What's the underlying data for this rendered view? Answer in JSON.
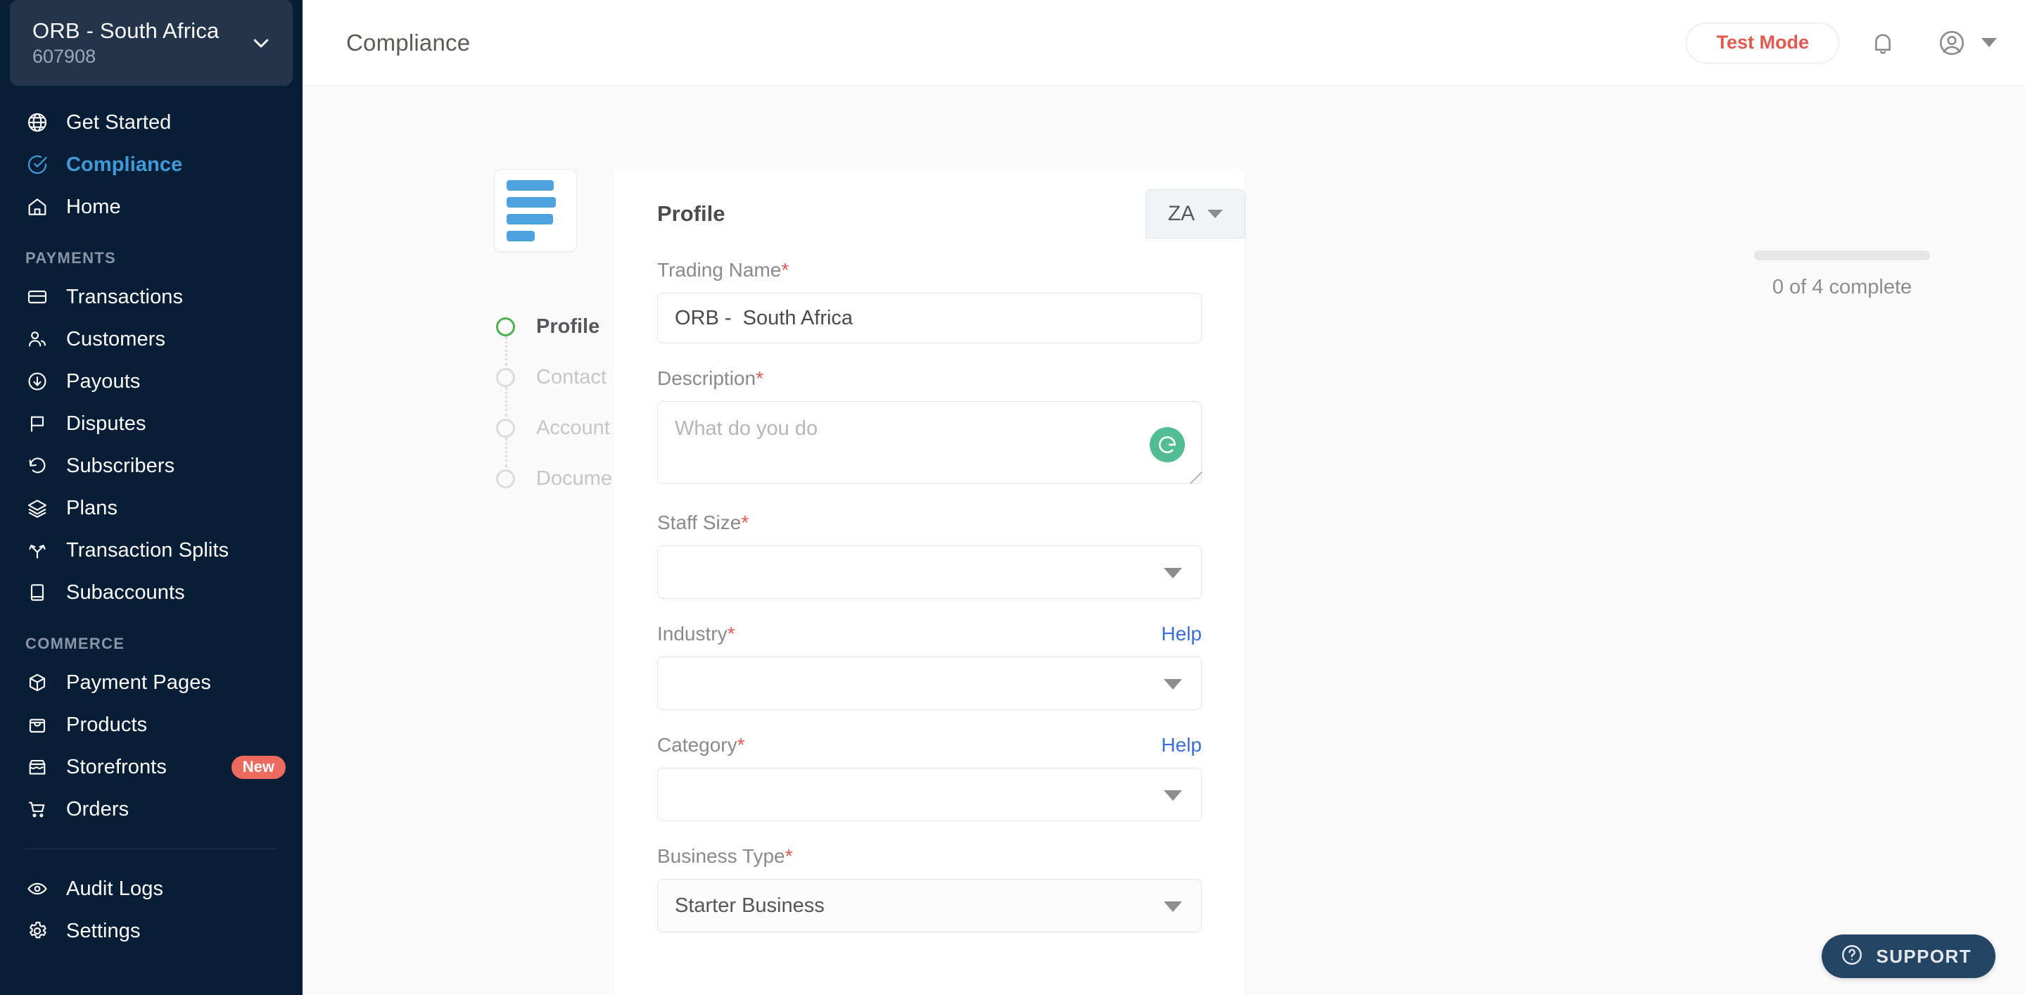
{
  "sidebar": {
    "account": {
      "name": "ORB - South Africa",
      "id": "607908",
      "chevron_icon": "chevron-down-icon"
    },
    "primary": [
      {
        "label": "Get Started",
        "icon": "globe-icon",
        "active": false
      },
      {
        "label": "Compliance",
        "icon": "check-circle-icon",
        "active": true
      },
      {
        "label": "Home",
        "icon": "home-icon",
        "active": false
      }
    ],
    "sections": [
      {
        "title": "PAYMENTS",
        "items": [
          {
            "label": "Transactions",
            "icon": "card-icon"
          },
          {
            "label": "Customers",
            "icon": "users-icon"
          },
          {
            "label": "Payouts",
            "icon": "arrow-down-circle-icon"
          },
          {
            "label": "Disputes",
            "icon": "flag-icon"
          },
          {
            "label": "Subscribers",
            "icon": "refresh-ccw-icon"
          },
          {
            "label": "Plans",
            "icon": "layers-icon"
          },
          {
            "label": "Transaction Splits",
            "icon": "split-icon"
          },
          {
            "label": "Subaccounts",
            "icon": "book-icon"
          }
        ]
      },
      {
        "title": "COMMERCE",
        "items": [
          {
            "label": "Payment Pages",
            "icon": "package-icon"
          },
          {
            "label": "Products",
            "icon": "shopping-bag-icon"
          },
          {
            "label": "Storefronts",
            "icon": "storefront-icon",
            "badge": "New"
          },
          {
            "label": "Orders",
            "icon": "shopping-cart-icon"
          }
        ]
      }
    ],
    "footer_items": [
      {
        "label": "Audit Logs",
        "icon": "eye-icon"
      },
      {
        "label": "Settings",
        "icon": "gear-icon"
      }
    ]
  },
  "topbar": {
    "title": "Compliance",
    "test_mode_label": "Test Mode",
    "bell_icon": "bell-icon",
    "avatar_icon": "user-circle-icon",
    "caret_icon": "caret-down-icon",
    "accent_red": "#e2594f"
  },
  "stepper": {
    "logo_alt": "business-logo-placeholder",
    "steps": [
      {
        "label": "Profile",
        "state": "current"
      },
      {
        "label": "Contact",
        "state": "pending"
      },
      {
        "label": "Account",
        "state": "pending"
      },
      {
        "label": "Documents",
        "state": "pending"
      }
    ]
  },
  "form": {
    "card_title": "Profile",
    "country": {
      "code": "ZA",
      "chevron_icon": "caret-down-icon"
    },
    "required_marker": "*",
    "help_label": "Help",
    "fields": [
      {
        "label": "Trading Name",
        "value": "ORB -  South Africa",
        "placeholder": "",
        "type": "text",
        "required": true
      },
      {
        "label": "Description",
        "value": "",
        "placeholder": "What do you do",
        "type": "textarea",
        "required": true,
        "assistant_icon": "grammarly-icon"
      },
      {
        "label": "Staff Size",
        "value": "",
        "type": "select",
        "required": true
      },
      {
        "label": "Industry",
        "value": "",
        "type": "select",
        "required": true,
        "help": true
      },
      {
        "label": "Category",
        "value": "",
        "type": "select",
        "required": true,
        "help": true
      },
      {
        "label": "Business Type",
        "value": "Starter Business",
        "type": "select",
        "required": true
      }
    ]
  },
  "progress": {
    "percent": 0,
    "text": "0 of 4 complete"
  },
  "support": {
    "label": "SUPPORT",
    "icon": "question-circle-icon"
  }
}
